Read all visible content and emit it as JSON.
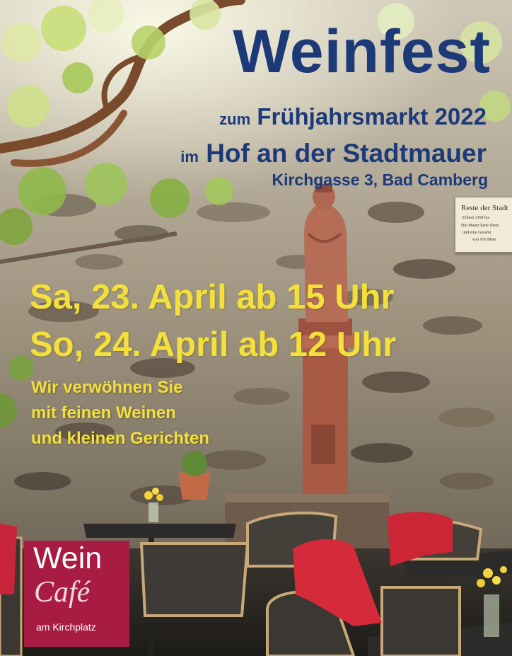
{
  "poster": {
    "title": "Weinfest",
    "line1_prefix": "zum",
    "line1_main": "Frühjahrsmarkt 2022",
    "line2_prefix": "im",
    "line2_main": "Hof an der Stadtmauer",
    "address": "Kirchgasse 3, Bad Camberg",
    "date_sat": "Sa, 23. April ab 15 Uhr",
    "date_sun": "So, 24. April ab 12 Uhr",
    "tagline": [
      "Wir verwöhnen Sie",
      "mit feinen Weinen",
      "und kleinen Gerichten"
    ]
  },
  "plaque": {
    "heading": "Reste der Stadt",
    "lines": [
      "Erbaut 1369 bis",
      "Die Mauer hatte ehem",
      "und eine Gesamt",
      "von 970 Mete"
    ]
  },
  "logo": {
    "wein": "Wein",
    "cafe": "Café",
    "place": "am Kirchplatz"
  },
  "colors": {
    "title_blue": "#1d3a78",
    "date_yellow": "#f3e03b",
    "logo_red": "#a81c43",
    "stone_wall": "#8a8476"
  }
}
